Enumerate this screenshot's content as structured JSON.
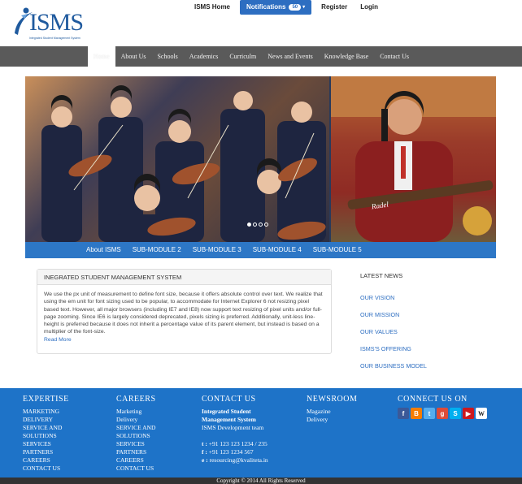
{
  "logo": {
    "text": "ISMS",
    "tagline": "Integrated Student Management System"
  },
  "topnav": {
    "home": "ISMS Home",
    "notifications": "Notifications",
    "notifications_count": "50",
    "register": "Register",
    "login": "Login"
  },
  "mainnav": [
    "Home",
    "About Us",
    "Schools",
    "Academics",
    "Curriculm",
    "News and Events",
    "Knowledge Base",
    "Contact Us"
  ],
  "submenu": [
    "About ISMS",
    "SUB-MODULE 2",
    "SUB-MODULE 3",
    "SUB-MODULE 4",
    "SUB-MODULE 5"
  ],
  "panel": {
    "title": "INEGRATED STUDENT MANAGEMENT SYSTEM",
    "body": "We use the px unit of measurement to define font size, because it offers absolute control over text. We realize that using the em unit for font sizing used to be popular, to accommodate for Internet Explorer 6 not resizing pixel based text. However, all major browsers (including IE7 and IE8) now support text resizing of pixel units and/or full-page zooming. Since IE6 is largely considered deprecated, pixels sizing is preferred. Additionally, unit-less line-height is preferred because it does not inherit a percentage value of its parent element, but instead is based on a multiplier of the font-size.",
    "read_more": "Read More"
  },
  "news": {
    "heading": "LATEST NEWS",
    "links": [
      "OUR VISION",
      "OUR MISSION",
      "OUR VALUES",
      "ISMS'S OFFERING",
      "OUR BUSINESS MODEL"
    ]
  },
  "footer": {
    "expertise": {
      "heading": "EXPERTISE",
      "items": [
        "MARKETING",
        "DELIVERY",
        "SERVICE AND",
        "SOLUTIONS",
        "SERVICES",
        "PARTNERS",
        "CAREERS",
        "CONTACT US"
      ]
    },
    "careers": {
      "heading": "CAREERS",
      "items": [
        "Marketing",
        "Delivery",
        "SERVICE AND",
        "SOLUTIONS",
        "SERVICES",
        "PARTNERS",
        "CAREERS",
        "CONTACT US"
      ]
    },
    "contact": {
      "heading": "CONTACT US",
      "org1": "Integrated Student",
      "org2": "Management System",
      "team": "ISMS Development team",
      "tel_label": "t :",
      "tel": "+91 123 123 1234 / 235",
      "fax_label": "f :",
      "fax": "+91 123 1234 567",
      "email_label": "e :",
      "email": "resourcing@kvaliteta.in"
    },
    "newsroom": {
      "heading": "NEWSROOM",
      "items": [
        "Magazine",
        "Delivery"
      ]
    },
    "connect": {
      "heading": "CONNECT US ON"
    },
    "copyright": "Copyright © 2014 All Rights Reserved"
  },
  "social_icons": [
    "facebook-icon",
    "blogger-icon",
    "twitter-icon",
    "google-plus-icon",
    "skype-icon",
    "youtube-icon",
    "wikipedia-icon"
  ],
  "colors": {
    "brand": "#1f5a9e",
    "accent": "#2d77c6",
    "nav": "#5a5a5a",
    "footer": "#1e73c8"
  }
}
